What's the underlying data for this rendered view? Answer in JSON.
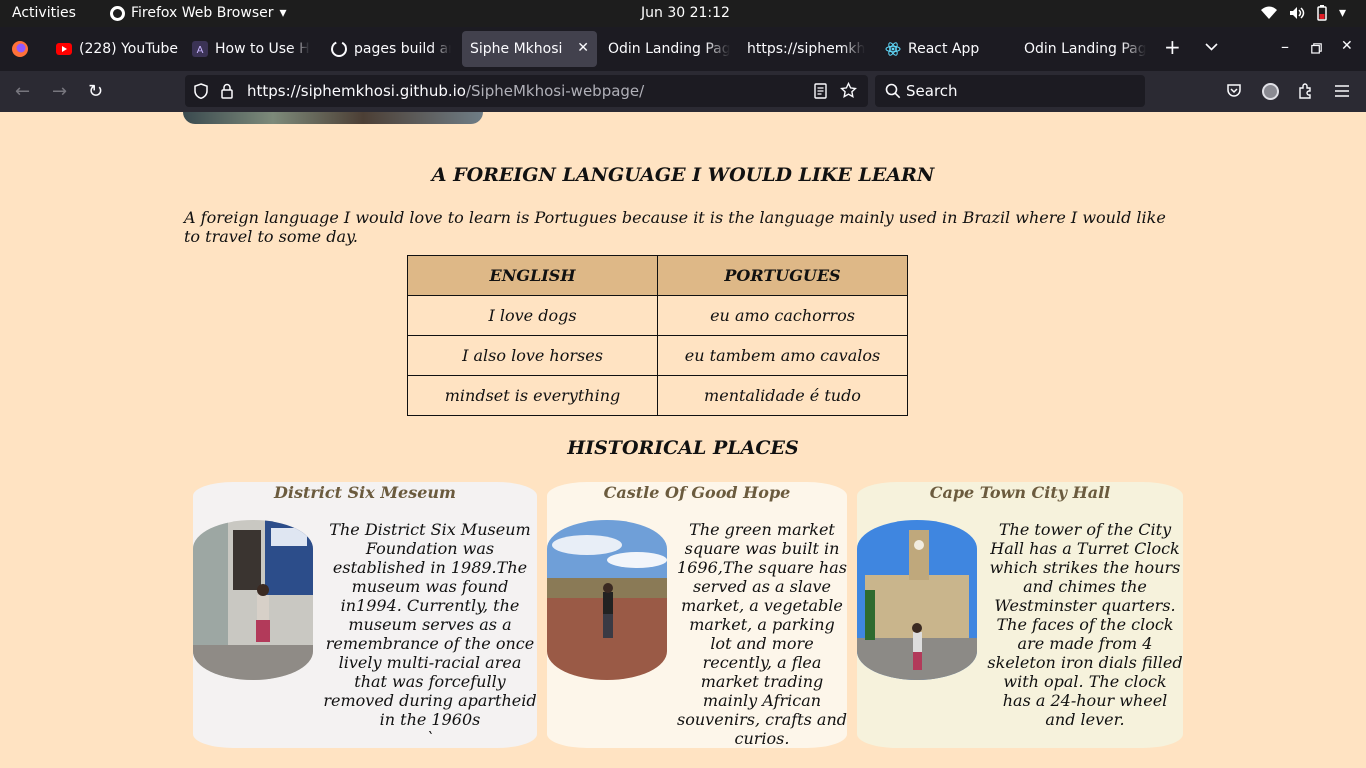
{
  "system_bar": {
    "activities": "Activities",
    "app_name": "Firefox Web Browser",
    "clock": "Jun 30  21:12"
  },
  "tabs": [
    {
      "label": "(228) YouTube",
      "icon": "youtube-icon"
    },
    {
      "label": "How to Use HT",
      "icon": "a-logo-icon"
    },
    {
      "label": "pages build ar",
      "icon": "github-icon"
    },
    {
      "label": "Siphe Mkhosi",
      "icon": "",
      "active": true
    },
    {
      "label": "Odin Landing Pag",
      "icon": ""
    },
    {
      "label": "https://siphemkh",
      "icon": ""
    },
    {
      "label": "React App",
      "icon": "react-icon"
    },
    {
      "label": "Odin Landing Pag",
      "icon": ""
    }
  ],
  "navbar": {
    "url_host": "https://siphemkhosi.github.io",
    "url_path": "/SipheMkhosi-webpage/",
    "search_placeholder": "Search"
  },
  "page": {
    "language_heading": "A FOREIGN LANGUAGE I WOULD LIKE LEARN",
    "language_paragraph": "A foreign language I would love to learn is Portugues because it is the language mainly used in Brazil where I would like to travel to some day.",
    "table": {
      "headers": [
        "ENGLISH",
        "PORTUGUES"
      ],
      "rows": [
        [
          "I love dogs",
          "eu amo cachorros"
        ],
        [
          "I also love horses",
          "eu tambem amo cavalos"
        ],
        [
          "mindset is everything",
          "mentalidade é tudo"
        ]
      ]
    },
    "places_heading": "HISTORICAL PLACES",
    "places": [
      {
        "title": "District Six Meseum",
        "text": "The District Six Museum Foundation was established in 1989.The museum was found in1994. Currently, the museum serves as a remembrance of the once lively multi-racial area that was forcefully removed during apartheid in the 1960s",
        "trailing": "`",
        "bg": "#f4f2f2"
      },
      {
        "title": "Castle Of Good Hope",
        "text": "The green market square was built in 1696,The square has served as a slave market, a vegetable market, a parking lot and more recently, a flea market trading mainly African souvenirs, crafts and curios.",
        "bg": "#fdf6ea"
      },
      {
        "title": "Cape Town City Hall",
        "text": "The tower of the City Hall has a Turret Clock which strikes the hours and chimes the Westminster quarters. The faces of the clock are made from 4 skeleton iron dials filled with opal. The clock has a 24-hour wheel and lever.",
        "bg": "#f6f2dc"
      }
    ]
  }
}
